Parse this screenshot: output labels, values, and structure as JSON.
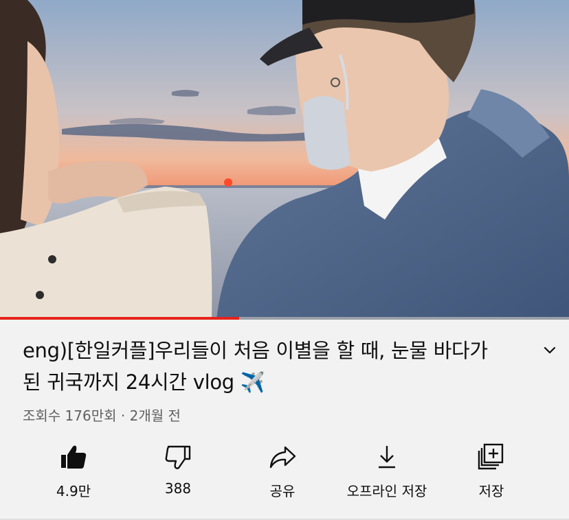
{
  "video": {
    "thumbnail_icon": "video-frame-sunset-couple",
    "progress_fraction": 0.42,
    "progress_color": "#e6231b"
  },
  "title": "eng)[한일커플]우리들이 처음 이별을 할 때, 눈물 바다가 된 귀국까지 24시간 vlog ✈️",
  "meta": {
    "views": "조회수 176만회",
    "separator": " · ",
    "age": "2개월 전"
  },
  "actions": {
    "like": {
      "label": "4.9만",
      "icon": "thumbs-up-icon"
    },
    "dislike": {
      "label": "388",
      "icon": "thumbs-down-icon"
    },
    "share": {
      "label": "공유",
      "icon": "share-icon"
    },
    "download": {
      "label": "오프라인 저장",
      "icon": "download-icon"
    },
    "save": {
      "label": "저장",
      "icon": "playlist-add-icon"
    }
  }
}
